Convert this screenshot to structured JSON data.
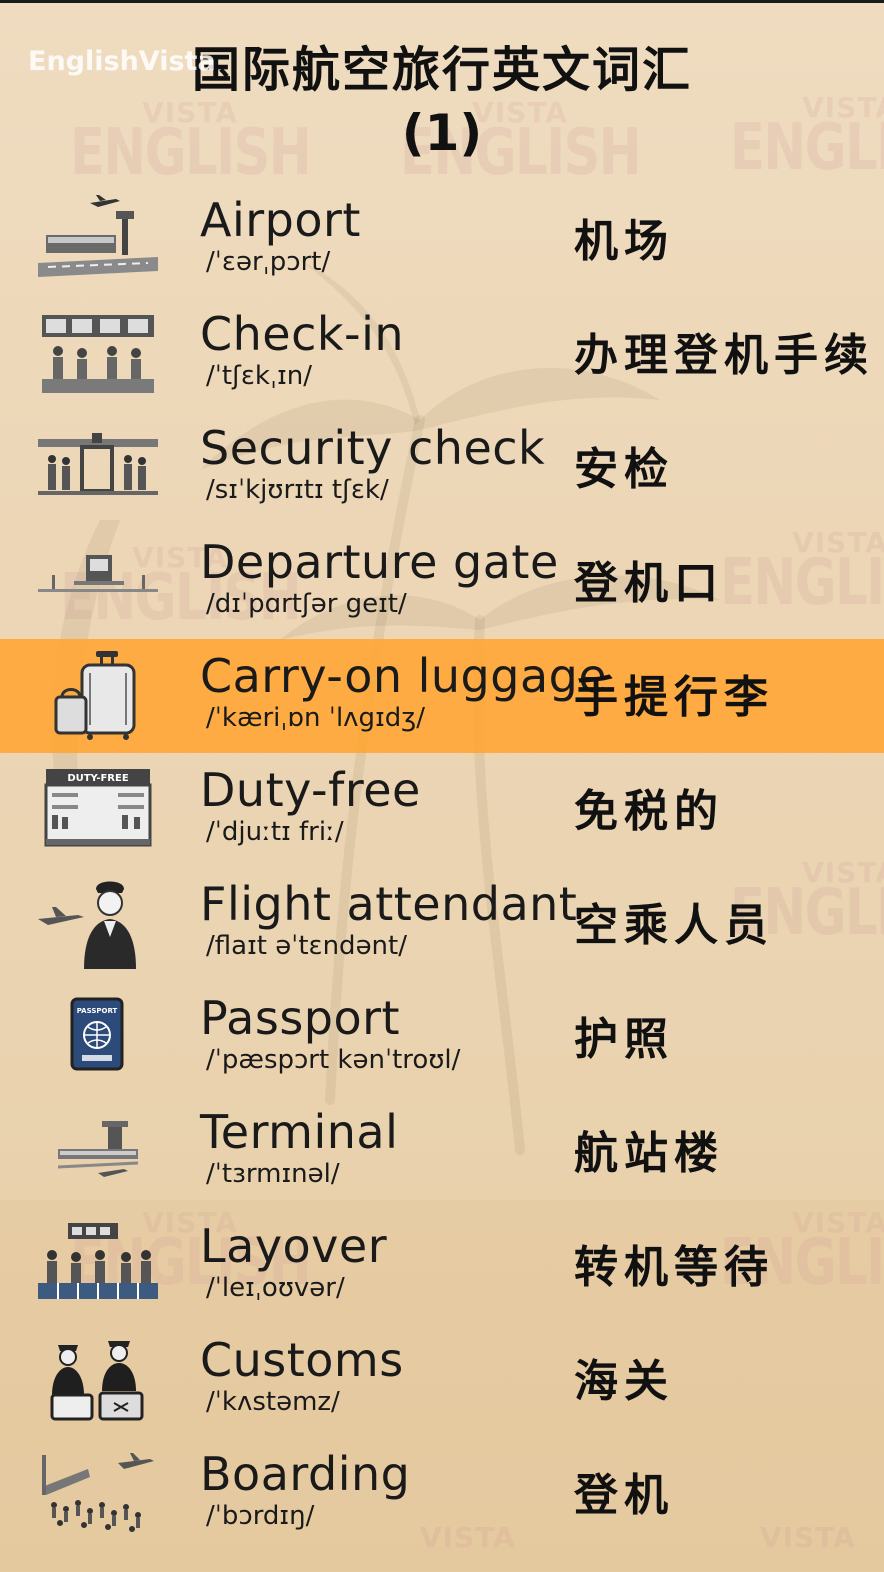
{
  "header": {
    "site_label": "EnglishVista",
    "title": "国际航空旅行英文词汇",
    "number": "(1)"
  },
  "watermark": {
    "line1": "VISTA",
    "line2": "ENGLISH"
  },
  "colors": {
    "highlight": "#ffa532",
    "text": "#1a1a1a",
    "background": "#ecd6b6"
  },
  "vocab": [
    {
      "term": "Airport",
      "ipa": "/ˈɛərˌpɔrt/",
      "cn": "机场",
      "icon": "airport-icon",
      "highlighted": false
    },
    {
      "term": "Check-in",
      "ipa": "/ˈtʃɛkˌɪn/",
      "cn": "办理登机手续",
      "icon": "check-in-counter-icon",
      "highlighted": false
    },
    {
      "term": "Security check",
      "ipa": "/sɪˈkjʊrɪtɪ tʃɛk/",
      "cn": "安检",
      "icon": "security-check-icon",
      "highlighted": false
    },
    {
      "term": "Departure gate",
      "ipa": "/dɪˈpɑrtʃər geɪt/",
      "cn": "登机口",
      "icon": "departure-gate-icon",
      "highlighted": false
    },
    {
      "term": "Carry-on luggage",
      "ipa": "/ˈkæriˌɒn ˈlʌgɪdʒ/",
      "cn": "手提行李",
      "icon": "luggage-icon",
      "highlighted": true
    },
    {
      "term": "Duty-free",
      "ipa": "/ˈdjuːtɪ friː/",
      "cn": "免税的",
      "icon": "duty-free-shop-icon",
      "highlighted": false
    },
    {
      "term": "Flight attendant",
      "ipa": "/flaɪt əˈtɛndənt/",
      "cn": "空乘人员",
      "icon": "flight-attendant-icon",
      "highlighted": false
    },
    {
      "term": "Passport",
      "ipa": "/ˈpæspɔrt kənˈtroʊl/",
      "cn": "护照",
      "icon": "passport-icon",
      "highlighted": false
    },
    {
      "term": "Terminal",
      "ipa": "/ˈtɜrmɪnəl/",
      "cn": "航站楼",
      "icon": "terminal-icon",
      "highlighted": false
    },
    {
      "term": "Layover",
      "ipa": "/ˈleɪˌoʊvər/",
      "cn": "转机等待",
      "icon": "layover-icon",
      "highlighted": false
    },
    {
      "term": "Customs",
      "ipa": "/ˈkʌstəmz/",
      "cn": "海关",
      "icon": "customs-icon",
      "highlighted": false
    },
    {
      "term": "Boarding",
      "ipa": "/ˈbɔrdɪŋ/",
      "cn": "登机",
      "icon": "boarding-icon",
      "highlighted": false
    }
  ]
}
